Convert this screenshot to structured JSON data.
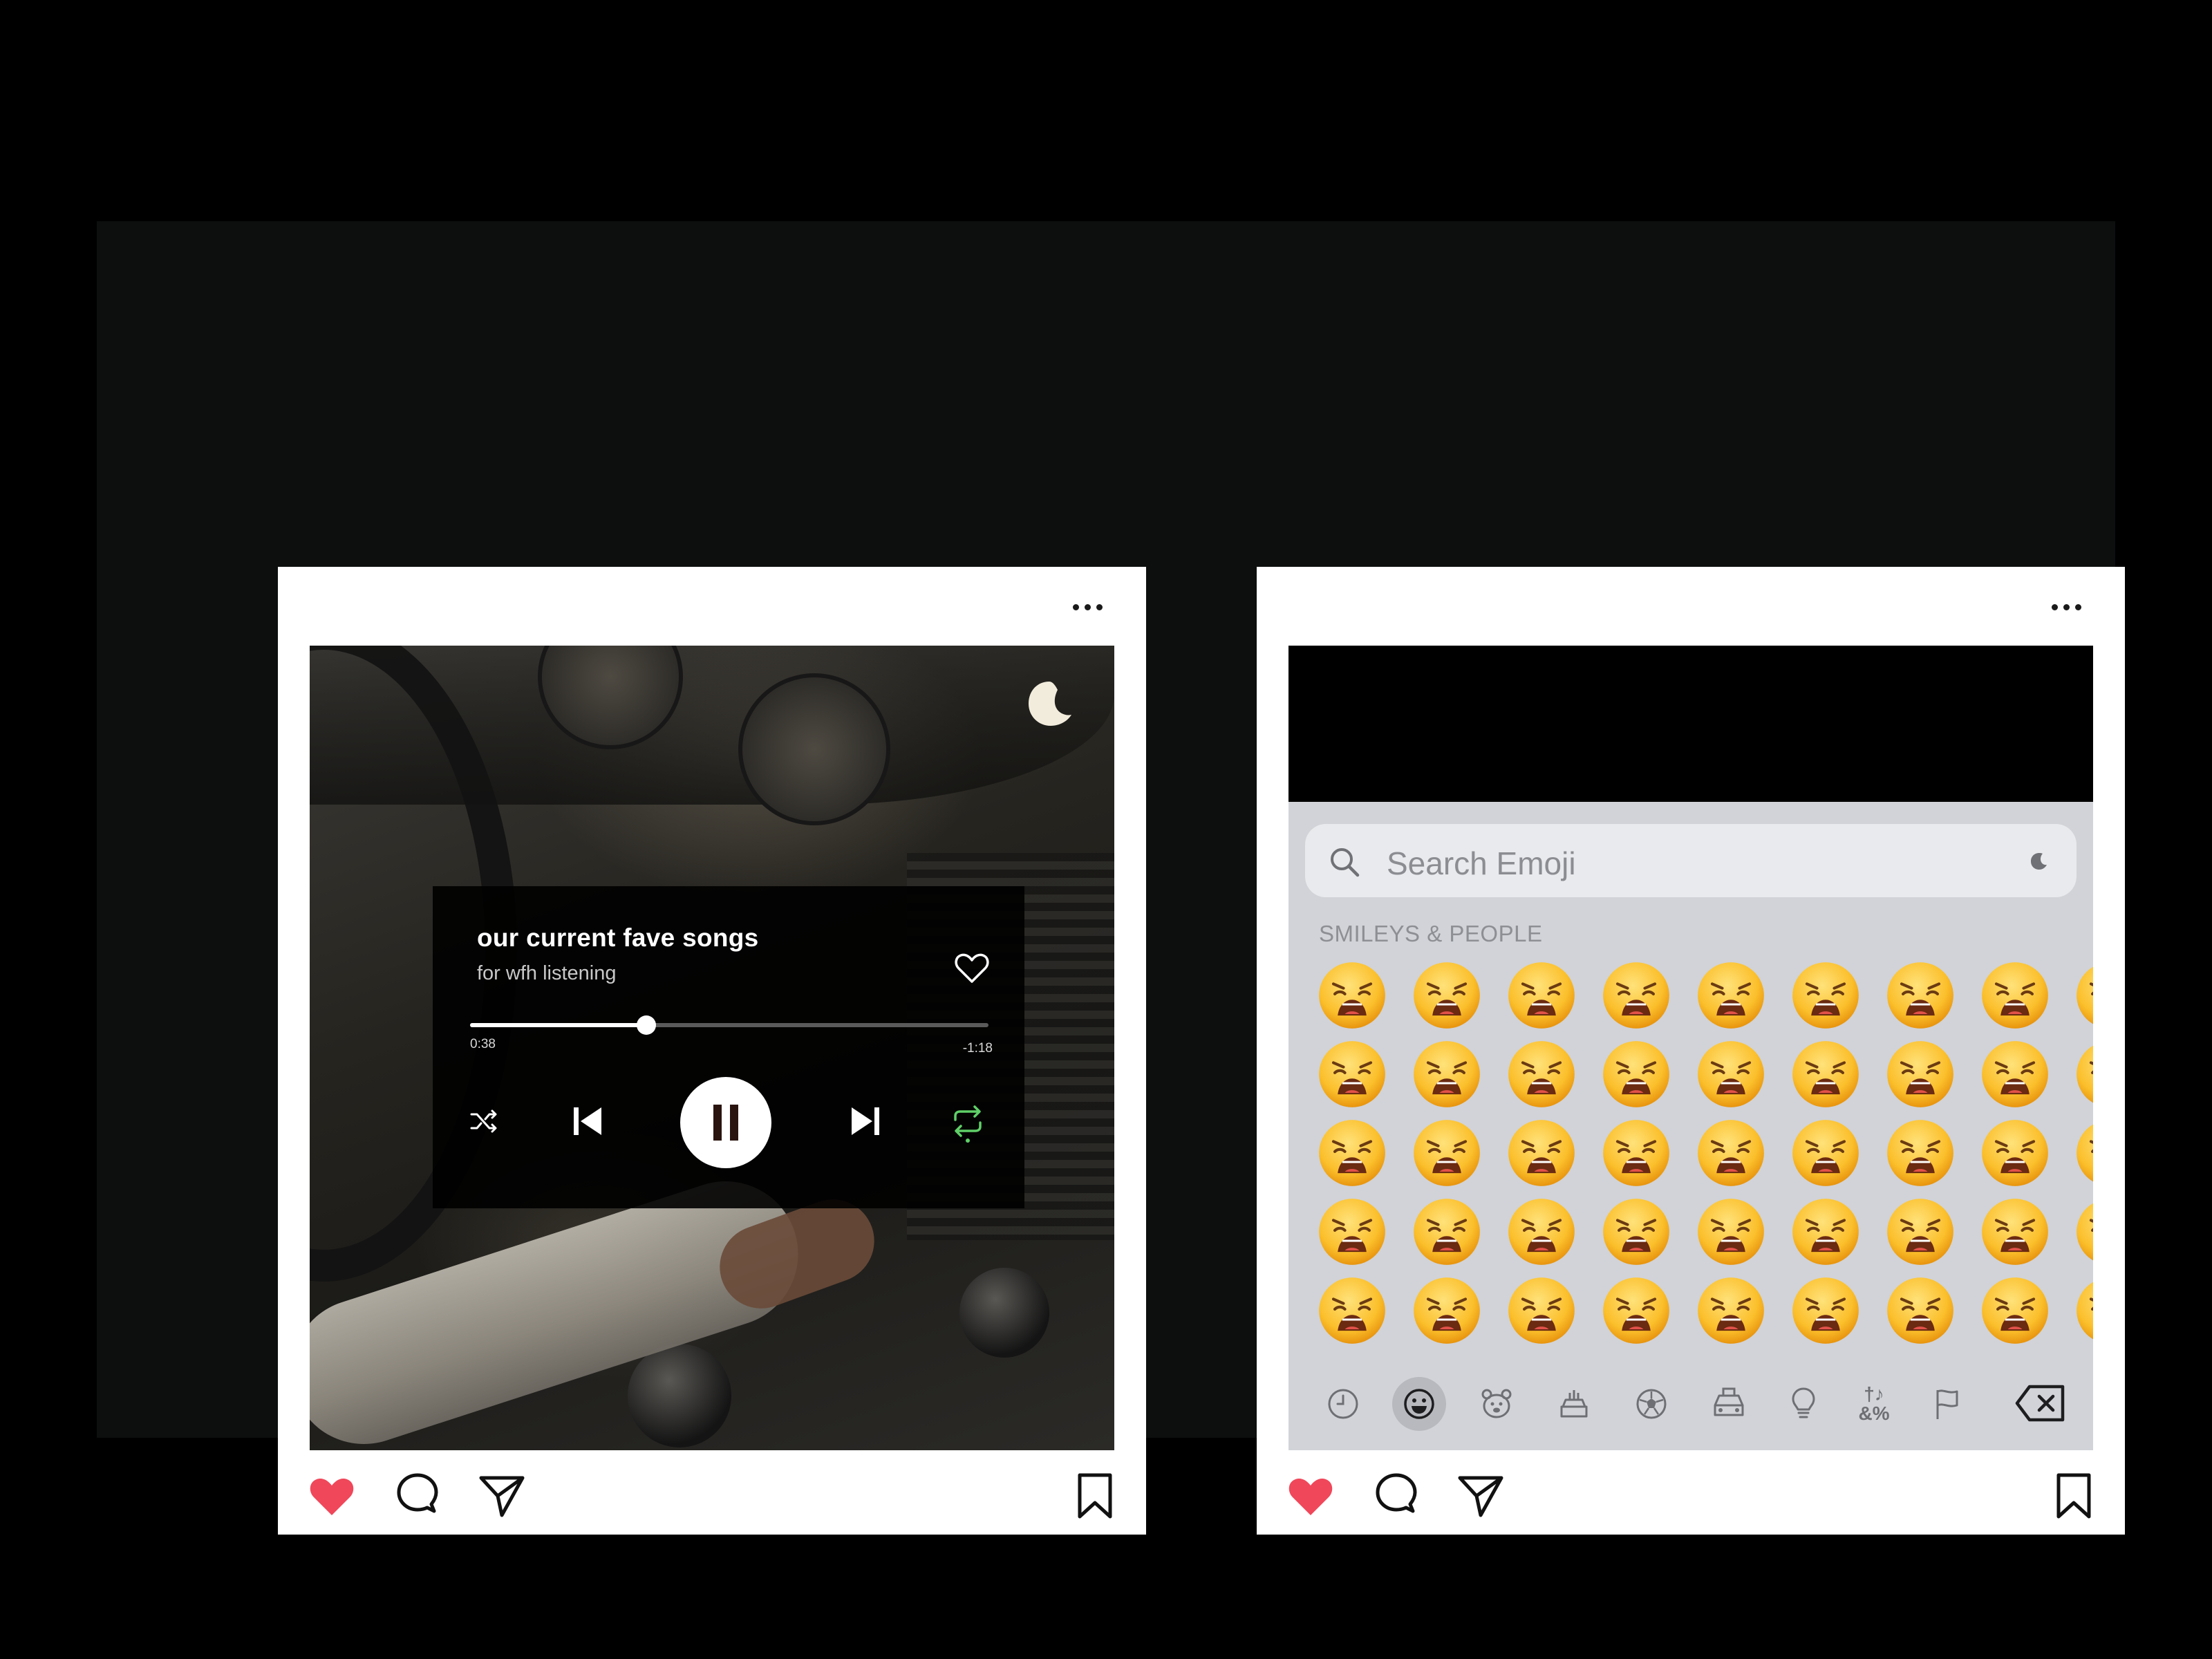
{
  "colors": {
    "page_background": "#000000",
    "stage_background": "#0d0f0f",
    "card_background": "#ffffff",
    "like_red": "#f0475a",
    "repeat_green": "#5fd068",
    "keyboard_gray": "#d1d3d8"
  },
  "music_post": {
    "more_icon": "ellipsis-icon",
    "badge_icon": "moon-icon",
    "player": {
      "title": "our current fave songs",
      "subtitle": "for wfh listening",
      "elapsed": "0:38",
      "remaining": "-1:18",
      "progress": 0.34,
      "liked": false,
      "playing": true,
      "repeat_on": true,
      "icons": [
        "shuffle-icon",
        "previous-icon",
        "pause-icon",
        "next-icon",
        "repeat-icon",
        "heart-outline-icon"
      ]
    },
    "actions": {
      "liked": true,
      "icons": [
        "heart-filled-icon",
        "comment-icon",
        "share-icon",
        "bookmark-icon"
      ]
    }
  },
  "emoji_post": {
    "more_icon": "ellipsis-icon",
    "keyboard": {
      "search_placeholder": "Search Emoji",
      "section_label": "SMILEYS & PEOPLE",
      "emoji_name": "weary face",
      "rows": 5,
      "visible_columns": 8,
      "categories": [
        {
          "name": "recent-icon",
          "active": false
        },
        {
          "name": "smiley-icon",
          "active": true
        },
        {
          "name": "bear-icon",
          "active": false
        },
        {
          "name": "food-icon",
          "active": false
        },
        {
          "name": "ball-icon",
          "active": false
        },
        {
          "name": "car-icon",
          "active": false
        },
        {
          "name": "lightbulb-icon",
          "active": false
        },
        {
          "name": "symbols-icon",
          "active": false
        },
        {
          "name": "flag-icon",
          "active": false
        }
      ],
      "symbols_label": "†♪ &%",
      "delete_icon": "backspace-icon"
    },
    "actions": {
      "liked": true,
      "icons": [
        "heart-filled-icon",
        "comment-icon",
        "share-icon",
        "bookmark-icon"
      ]
    }
  }
}
